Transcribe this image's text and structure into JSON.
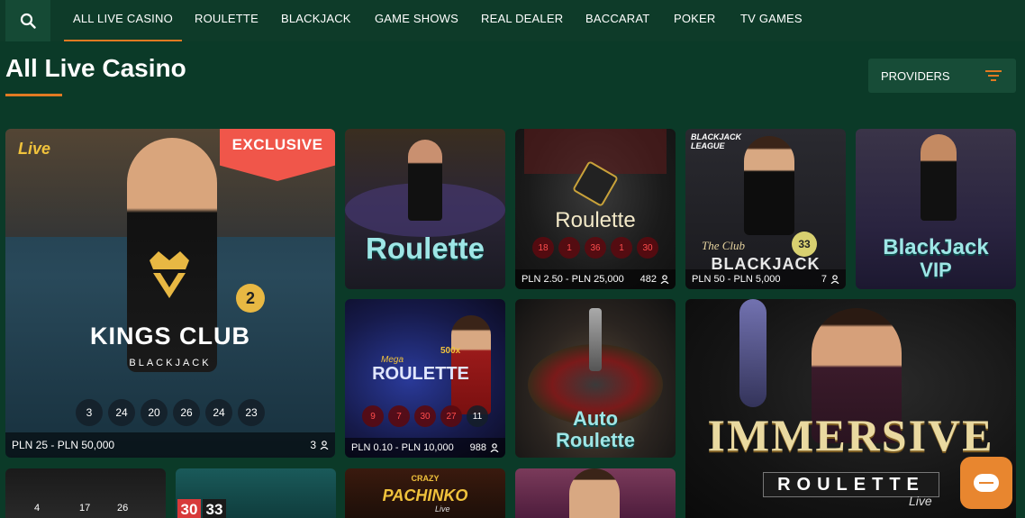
{
  "nav": {
    "tabs": [
      {
        "label": "ALL LIVE CASINO",
        "active": true
      },
      {
        "label": "ROULETTE"
      },
      {
        "label": "BLACKJACK"
      },
      {
        "label": "GAME SHOWS"
      },
      {
        "label": "REAL DEALER"
      },
      {
        "label": "BACCARAT"
      },
      {
        "label": "POKER"
      },
      {
        "label": "TV GAMES"
      }
    ]
  },
  "page": {
    "title": "All Live Casino",
    "providers_label": "PROVIDERS"
  },
  "tiles": [
    {
      "title": "KINGS CLUB",
      "subtitle": "BLACKJACK",
      "badge": "EXCLUSIVE",
      "corner_logo": "Live",
      "seat": "2",
      "numbers": [
        "3",
        "24",
        "20",
        "26",
        "24",
        "23"
      ],
      "limits": "PLN 25 - PLN 50,000",
      "players": "3"
    },
    {
      "title": "Roulette"
    },
    {
      "title": "Roulette",
      "numbers": [
        "18",
        "1",
        "36",
        "1",
        "30"
      ],
      "limits": "PLN 2.50 - PLN 25,000",
      "players": "482"
    },
    {
      "title": "BLACKJACK",
      "top_label": "BLACKJACK LEAGUE",
      "prefix": "The Club",
      "chip": "33",
      "limits": "PLN 50 - PLN 5,000",
      "players": "7"
    },
    {
      "title": "BlackJack",
      "subtitle": "VIP"
    },
    {
      "title": "ROULETTE",
      "prefix": "Mega",
      "multiplier": "500x",
      "numbers": [
        "9",
        "7",
        "30",
        "27",
        "11"
      ],
      "limits": "PLN 0.10 - PLN 10,000",
      "players": "988"
    },
    {
      "title": "Auto",
      "subtitle": "Roulette"
    },
    {
      "title": "IMMERSIVE",
      "subtitle": "ROULETTE",
      "suffix": "Live"
    },
    {
      "numbers": [
        "4",
        "17",
        "26"
      ]
    },
    {
      "numbers": [
        "30",
        "33"
      ]
    },
    {
      "prefix": "CRAZY",
      "title": "PACHINKO",
      "suffix": "Live"
    },
    {}
  ],
  "colors": {
    "background": "#0b3a28",
    "accent": "#e17a22",
    "chat": "#e8862f"
  }
}
